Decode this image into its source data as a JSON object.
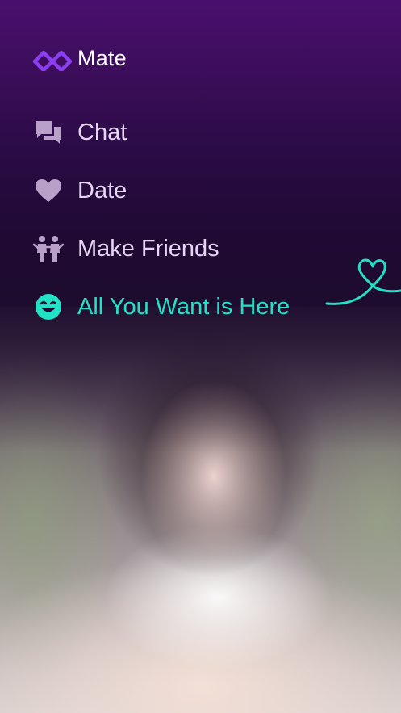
{
  "app": {
    "name": "Mate"
  },
  "menu": {
    "items": [
      {
        "label": "Chat",
        "icon": "chat-bubbles-icon"
      },
      {
        "label": "Date",
        "icon": "heart-icon"
      },
      {
        "label": "Make Friends",
        "icon": "friends-icon"
      },
      {
        "label": "All You Want is Here",
        "icon": "smiley-icon"
      }
    ]
  },
  "colors": {
    "accent": "#23e1c5",
    "brand_purple": "#8b3df0",
    "menu_text": "#e7d5f4",
    "menu_icon": "#b8a0c9",
    "background_top": "#4a0f6e"
  }
}
